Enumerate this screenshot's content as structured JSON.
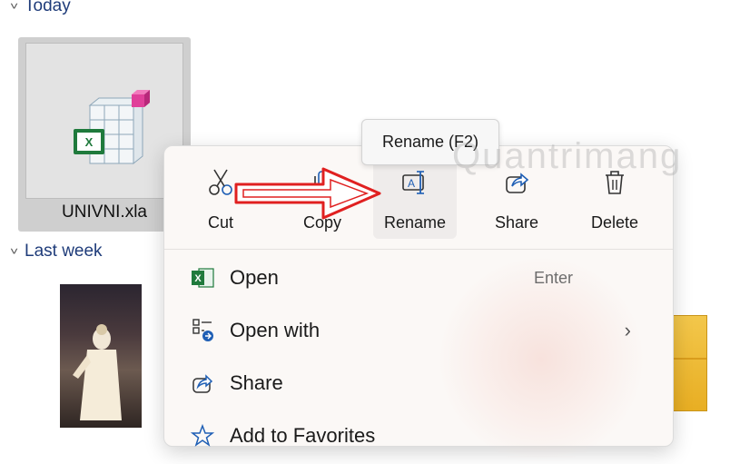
{
  "groups": {
    "today": "Today",
    "last_week": "Last week"
  },
  "file": {
    "name": "UNIVNI.xla"
  },
  "tooltip": "Rename (F2)",
  "watermark": "Quantrimang",
  "quick_actions": [
    {
      "label": "Cut",
      "icon": "scissors-icon"
    },
    {
      "label": "Copy",
      "icon": "copy-icon"
    },
    {
      "label": "Rename",
      "icon": "rename-icon"
    },
    {
      "label": "Share",
      "icon": "share-icon"
    },
    {
      "label": "Delete",
      "icon": "trash-icon"
    }
  ],
  "menu_items": [
    {
      "label": "Open",
      "shortcut": "Enter",
      "icon": "excel-icon"
    },
    {
      "label": "Open with",
      "shortcut": "",
      "icon": "open-with-icon",
      "has_submenu": true
    },
    {
      "label": "Share",
      "shortcut": "",
      "icon": "share-icon"
    },
    {
      "label": "Add to Favorites",
      "shortcut": "",
      "icon": "star-icon"
    }
  ],
  "colors": {
    "accent": "#1f5fb5",
    "annotation_arrow": "#e02020",
    "menu_bg": "#fbf8f6"
  }
}
